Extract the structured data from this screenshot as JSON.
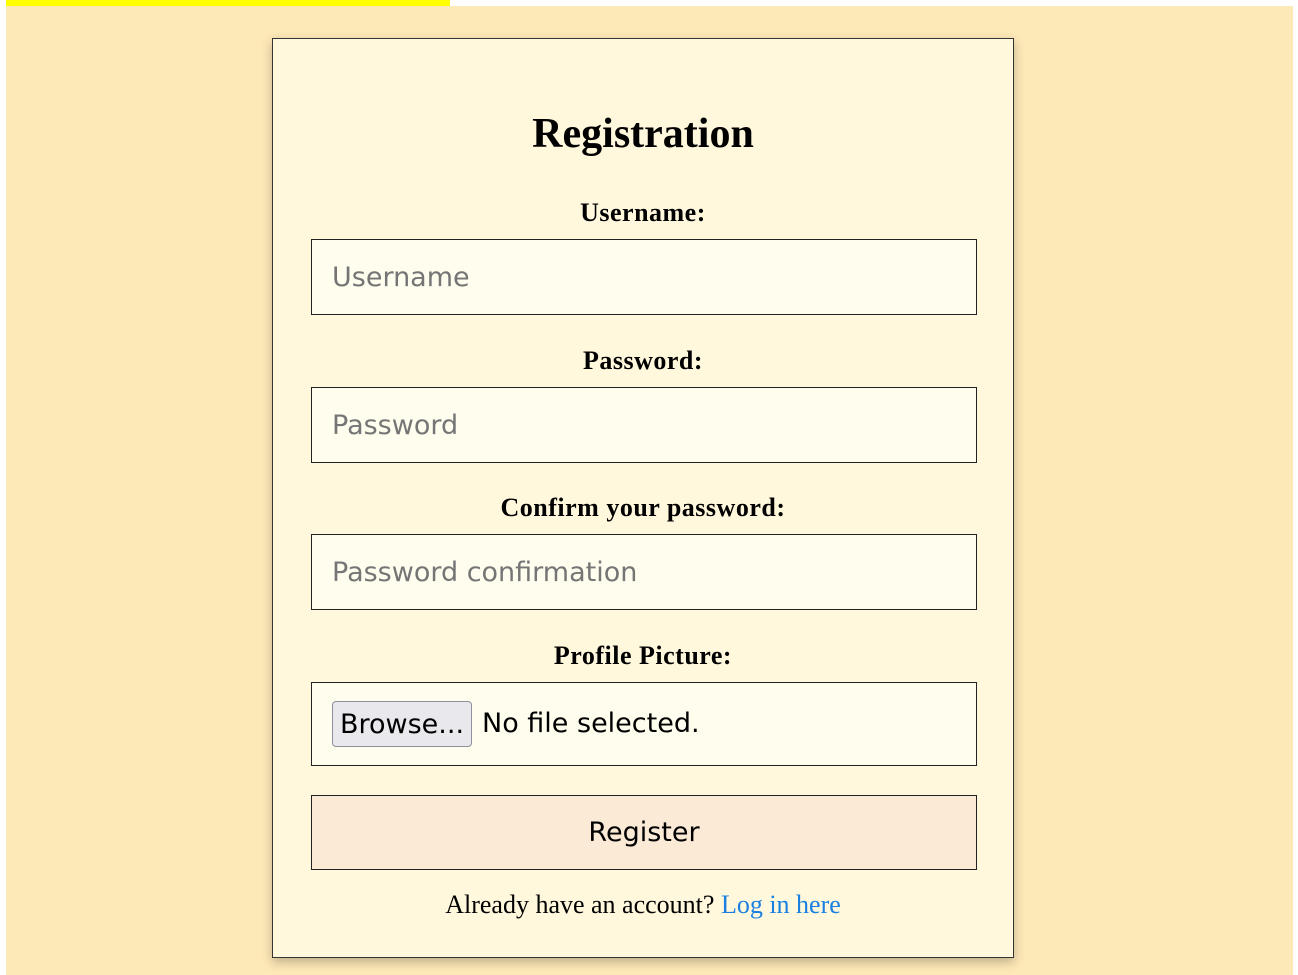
{
  "form": {
    "title": "Registration",
    "username": {
      "label": "Username:",
      "placeholder": "Username",
      "value": ""
    },
    "password": {
      "label": "Password:",
      "placeholder": "Password",
      "value": ""
    },
    "confirm_password": {
      "label": "Confirm your password:",
      "placeholder": "Password confirmation",
      "value": ""
    },
    "profile_picture": {
      "label": "Profile Picture:",
      "browse_label": "Browse...",
      "status": "No file selected."
    },
    "submit_label": "Register"
  },
  "footer": {
    "prompt": "Already have an account?",
    "link_label": "Log in here"
  },
  "colors": {
    "page_background": "#fde8b7",
    "card_background": "#fff8dc",
    "input_background": "#fffdee",
    "button_background": "#fbead6",
    "link": "#1a7fe0",
    "top_highlight": "#ffff00"
  }
}
